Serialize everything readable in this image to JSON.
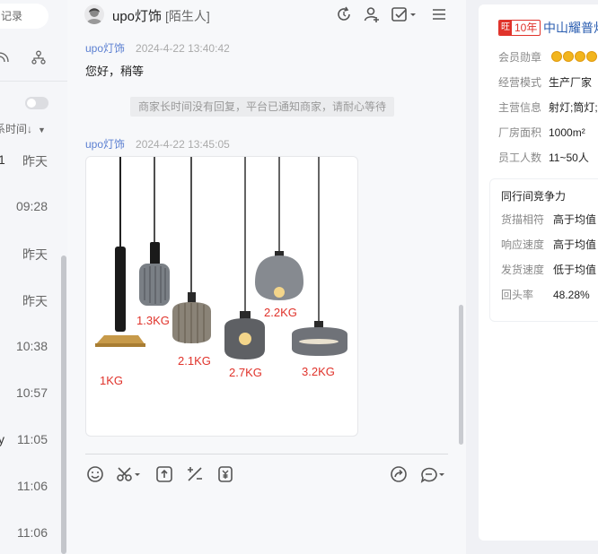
{
  "sidebar": {
    "search_placeholder": "记录",
    "sort_label": "系时间↓",
    "conversations": [
      {
        "lead": "1",
        "time": "昨天"
      },
      {
        "lead": "",
        "time": "09:28"
      },
      {
        "lead": "",
        "time": "昨天"
      },
      {
        "lead": "",
        "time": "昨天"
      },
      {
        "lead": "",
        "time": "10:38"
      },
      {
        "lead": "",
        "time": "10:57"
      },
      {
        "lead": "y",
        "time": "11:05"
      },
      {
        "lead": "",
        "time": "11:06"
      },
      {
        "lead": "",
        "time": "11:06"
      }
    ]
  },
  "chat": {
    "contact_name": "upo灯饰",
    "contact_tag": "[陌生人]",
    "messages": [
      {
        "sender": "upo灯饰",
        "time": "2024-4-22 13:40:42",
        "text": "您好，稍等"
      },
      {
        "sender": "upo灯饰",
        "time": "2024-4-22 13:45:05"
      }
    ],
    "system_notice": "商家长时间没有回复，平台已通知商家，请耐心等待",
    "image_weights": [
      "1.3KG",
      "1KG",
      "2.1KG",
      "2.2KG",
      "2.7KG",
      "3.2KG"
    ]
  },
  "shop": {
    "badge_icon": "旺",
    "badge_years": "10年",
    "company_name": "中山耀普灯",
    "info": [
      {
        "key": "会员勋章",
        "value": ""
      },
      {
        "key": "经营模式",
        "value": "生产厂家"
      },
      {
        "key": "主营信息",
        "value": "射灯;筒灯;"
      },
      {
        "key": "厂房面积",
        "value": "1000m²"
      },
      {
        "key": "员工人数",
        "value": "11~50人"
      }
    ],
    "medals": 4,
    "competitiveness": {
      "title": "同行间竞争力",
      "rows": [
        {
          "key": "货描相符",
          "value": "高于均值"
        },
        {
          "key": "响应速度",
          "value": "高于均值"
        },
        {
          "key": "发货速度",
          "value": "低于均值"
        },
        {
          "key": "回头率",
          "value": "48.28%"
        }
      ]
    }
  }
}
